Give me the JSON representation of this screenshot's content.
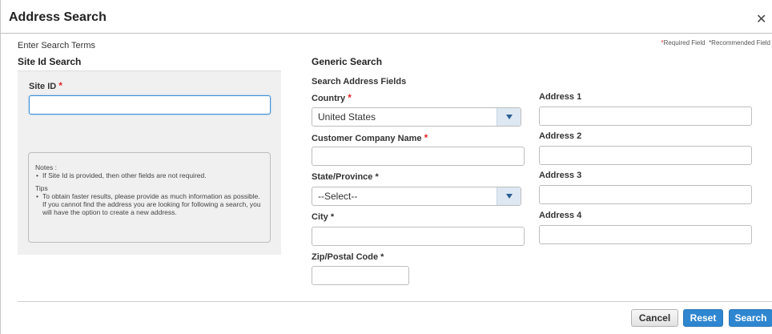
{
  "dialog": {
    "title": "Address Search",
    "close_icon": "close-icon"
  },
  "subtitle": "Enter Search Terms",
  "legend": {
    "required": "Required Field",
    "recommended": "*Recommended Field"
  },
  "site_search": {
    "heading": "Site Id Search",
    "site_id_label": "Site ID",
    "site_id_value": "",
    "notes_title": "Notes :",
    "notes": [
      "If Site Id is provided, then other fields are not required."
    ],
    "tips_title": "Tips",
    "tips": [
      "To obtain faster results, please provide as much information as possible. If you cannot find the address you are looking for following a search, you will have the option to create a new address."
    ]
  },
  "generic_search": {
    "heading": "Generic Search",
    "subheading": "Search Address Fields",
    "country_label": "Country",
    "country_value": "United States",
    "company_label": "Customer Company Name",
    "company_value": "",
    "state_label": "State/Province *",
    "state_value": "--Select--",
    "city_label": "City *",
    "city_value": "",
    "zip_label": "Zip/Postal Code *",
    "zip_value": "",
    "address1_label": "Address 1",
    "address2_label": "Address 2",
    "address3_label": "Address 3",
    "address4_label": "Address 4"
  },
  "buttons": {
    "cancel": "Cancel",
    "reset": "Reset",
    "search": "Search"
  },
  "colors": {
    "required_star": "#e3262c",
    "primary_button": "#2f86d0",
    "focus_border": "#3a8fd6",
    "panel_bg": "#f0f0f0"
  }
}
